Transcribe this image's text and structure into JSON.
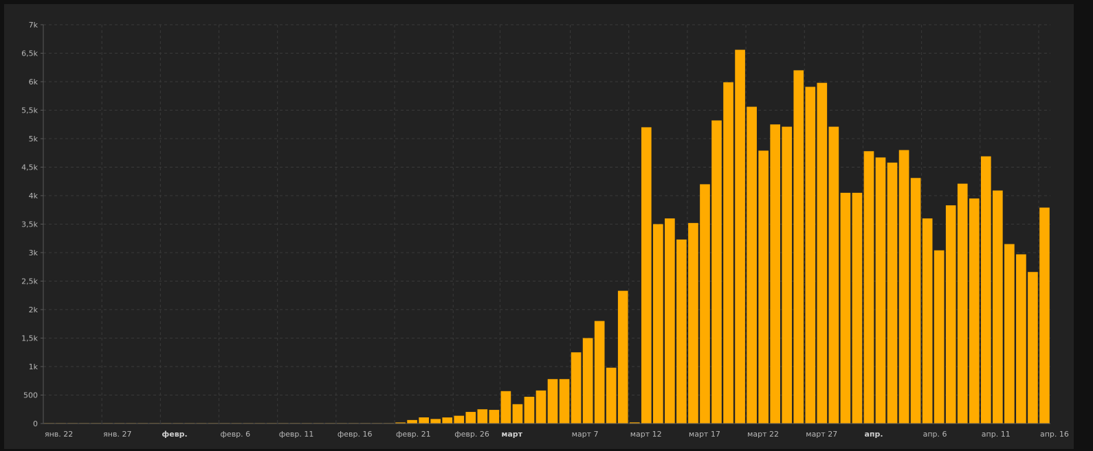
{
  "chart_data": {
    "type": "bar",
    "ylim": [
      0,
      7000
    ],
    "yticks": [
      {
        "value": 0,
        "label": "0"
      },
      {
        "value": 500,
        "label": "500"
      },
      {
        "value": 1000,
        "label": "1k"
      },
      {
        "value": 1500,
        "label": "1,5k"
      },
      {
        "value": 2000,
        "label": "2k"
      },
      {
        "value": 2500,
        "label": "2,5k"
      },
      {
        "value": 3000,
        "label": "3k"
      },
      {
        "value": 3500,
        "label": "3,5k"
      },
      {
        "value": 4000,
        "label": "4k"
      },
      {
        "value": 4500,
        "label": "4,5k"
      },
      {
        "value": 5000,
        "label": "5k"
      },
      {
        "value": 5500,
        "label": "5,5k"
      },
      {
        "value": 6000,
        "label": "6k"
      },
      {
        "value": 6500,
        "label": "6,5k"
      },
      {
        "value": 7000,
        "label": "7k"
      }
    ],
    "xticks": [
      {
        "date": "2020-01-22",
        "label": "янв. 22",
        "major": false
      },
      {
        "date": "2020-01-27",
        "label": "янв. 27",
        "major": false
      },
      {
        "date": "2020-02-01",
        "label": "февр.",
        "major": true
      },
      {
        "date": "2020-02-06",
        "label": "февр. 6",
        "major": false
      },
      {
        "date": "2020-02-11",
        "label": "февр. 11",
        "major": false
      },
      {
        "date": "2020-02-16",
        "label": "февр. 16",
        "major": false
      },
      {
        "date": "2020-02-21",
        "label": "февр. 21",
        "major": false
      },
      {
        "date": "2020-02-26",
        "label": "февр. 26",
        "major": false
      },
      {
        "date": "2020-03-01",
        "label": "март",
        "major": true
      },
      {
        "date": "2020-03-07",
        "label": "март 7",
        "major": false
      },
      {
        "date": "2020-03-12",
        "label": "март 12",
        "major": false
      },
      {
        "date": "2020-03-17",
        "label": "март 17",
        "major": false
      },
      {
        "date": "2020-03-22",
        "label": "март 22",
        "major": false
      },
      {
        "date": "2020-03-27",
        "label": "март 27",
        "major": false
      },
      {
        "date": "2020-04-01",
        "label": "апр.",
        "major": true
      },
      {
        "date": "2020-04-06",
        "label": "апр. 6",
        "major": false
      },
      {
        "date": "2020-04-11",
        "label": "апр. 11",
        "major": false
      },
      {
        "date": "2020-04-16",
        "label": "апр. 16",
        "major": false
      }
    ],
    "grid": true,
    "colors": {
      "bar": "#ffab00",
      "background": "#222222"
    },
    "x": [
      "2020-01-22",
      "2020-01-23",
      "2020-01-24",
      "2020-01-25",
      "2020-01-26",
      "2020-01-27",
      "2020-01-28",
      "2020-01-29",
      "2020-01-30",
      "2020-01-31",
      "2020-02-01",
      "2020-02-02",
      "2020-02-03",
      "2020-02-04",
      "2020-02-05",
      "2020-02-06",
      "2020-02-07",
      "2020-02-08",
      "2020-02-09",
      "2020-02-10",
      "2020-02-11",
      "2020-02-12",
      "2020-02-13",
      "2020-02-14",
      "2020-02-15",
      "2020-02-16",
      "2020-02-17",
      "2020-02-18",
      "2020-02-19",
      "2020-02-20",
      "2020-02-21",
      "2020-02-22",
      "2020-02-23",
      "2020-02-24",
      "2020-02-25",
      "2020-02-26",
      "2020-02-27",
      "2020-02-28",
      "2020-02-29",
      "2020-03-01",
      "2020-03-02",
      "2020-03-03",
      "2020-03-04",
      "2020-03-05",
      "2020-03-06",
      "2020-03-07",
      "2020-03-08",
      "2020-03-09",
      "2020-03-10",
      "2020-03-11",
      "2020-03-12",
      "2020-03-13",
      "2020-03-14",
      "2020-03-15",
      "2020-03-16",
      "2020-03-17",
      "2020-03-18",
      "2020-03-19",
      "2020-03-20",
      "2020-03-21",
      "2020-03-22",
      "2020-03-23",
      "2020-03-24",
      "2020-03-25",
      "2020-03-26",
      "2020-03-27",
      "2020-03-28",
      "2020-03-29",
      "2020-03-30",
      "2020-03-31",
      "2020-04-01",
      "2020-04-02",
      "2020-04-03",
      "2020-04-04",
      "2020-04-05",
      "2020-04-06",
      "2020-04-07",
      "2020-04-08",
      "2020-04-09",
      "2020-04-10",
      "2020-04-11",
      "2020-04-12",
      "2020-04-13",
      "2020-04-14",
      "2020-04-15",
      "2020-04-16"
    ],
    "values": [
      0,
      0,
      0,
      0,
      0,
      0,
      0,
      0,
      0,
      0,
      0,
      0,
      0,
      0,
      0,
      0,
      0,
      0,
      0,
      0,
      0,
      0,
      0,
      0,
      0,
      0,
      0,
      0,
      0,
      0,
      19,
      62,
      108,
      80,
      107,
      137,
      204,
      250,
      240,
      569,
      340,
      470,
      580,
      780,
      780,
      1250,
      1500,
      1800,
      980,
      2330,
      20,
      5200,
      3500,
      3600,
      3230,
      3520,
      4200,
      5320,
      5990,
      6560,
      5560,
      4790,
      5250,
      5210,
      6200,
      5910,
      5980,
      5210,
      4050,
      4050,
      4780,
      4670,
      4580,
      4800,
      4310,
      3600,
      3040,
      3830,
      4210,
      3950,
      4690,
      4090,
      3150,
      2970,
      2660,
      3790
    ]
  }
}
